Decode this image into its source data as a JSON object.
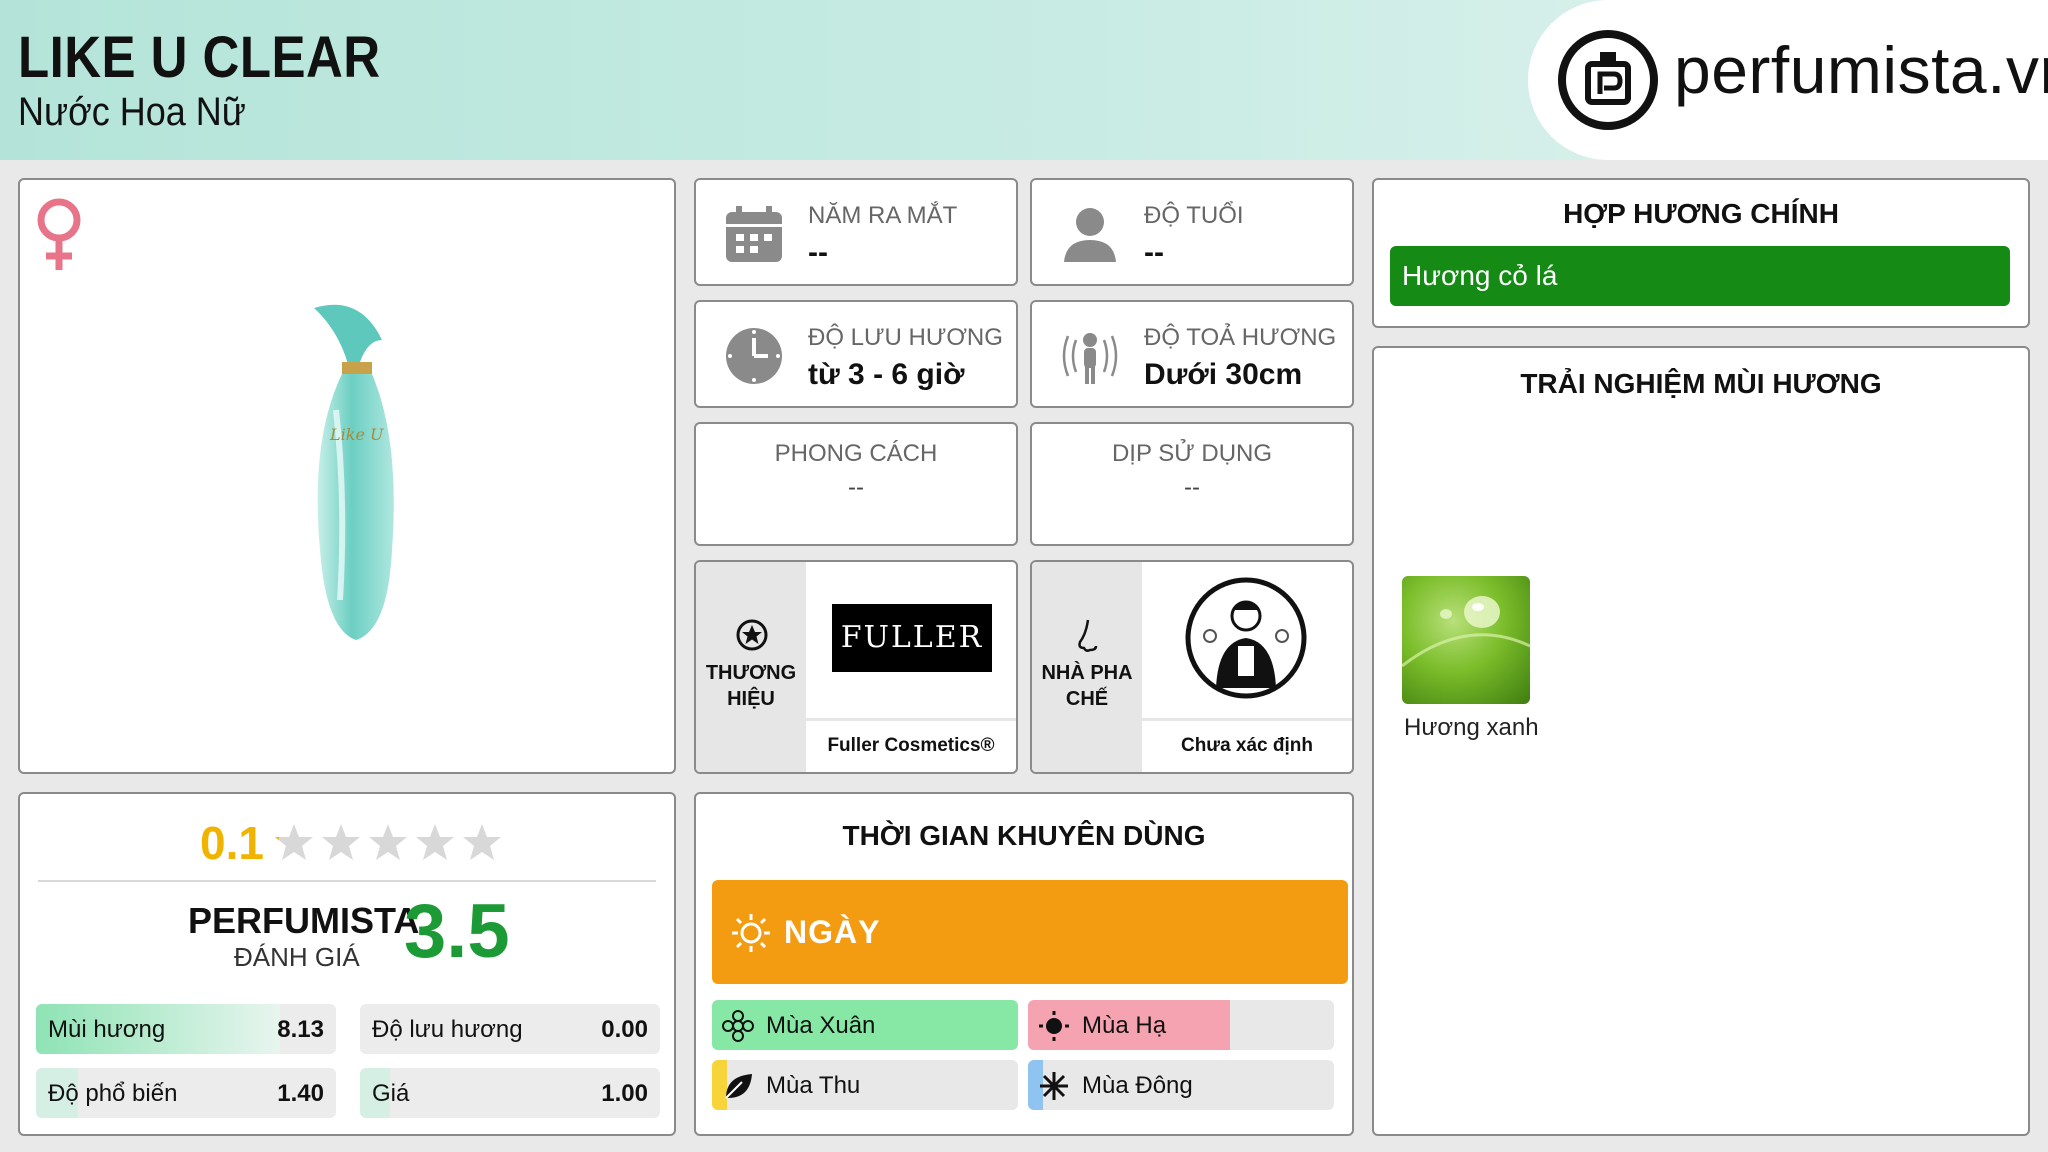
{
  "header": {
    "title": "LIKE U CLEAR",
    "subtitle": "Nước Hoa Nữ",
    "logo_text": "perfumista.vn"
  },
  "gender_icon": "female-icon",
  "info": {
    "launch_year": {
      "label": "NĂM RA MẮT",
      "value": "--",
      "icon": "calendar-icon"
    },
    "age": {
      "label": "ĐỘ TUỔI",
      "value": "--",
      "icon": "user-icon"
    },
    "longevity": {
      "label": "ĐỘ LƯU HƯƠNG",
      "value": "từ 3 - 6 giờ",
      "icon": "clock-icon"
    },
    "sillage": {
      "label": "ĐỘ TOẢ HƯƠNG",
      "value": "Dưới 30cm",
      "icon": "sillage-icon"
    },
    "style": {
      "label": "PHONG CÁCH",
      "value": "--"
    },
    "occasion": {
      "label": "DỊP SỬ DỤNG",
      "value": "--"
    }
  },
  "brand": {
    "label_line1": "THƯƠNG",
    "label_line2": "HIỆU",
    "logo_text": "FULLER",
    "name": "Fuller Cosmetics®"
  },
  "perfumer": {
    "label_line1": "NHÀ PHA",
    "label_line2": "CHẾ",
    "name": "Chưa xác định"
  },
  "rating": {
    "user_score": "0.1",
    "stars_total": 5,
    "stars_filled": 0.1,
    "perfumista_label": "PERFUMISTA",
    "perfumista_sub": "ĐÁNH GIÁ",
    "perfumista_score": "3.5",
    "metrics": [
      {
        "label": "Mùi hương",
        "value": "8.13",
        "fill": 0.813
      },
      {
        "label": "Độ lưu hương",
        "value": "0.00",
        "fill": 0.0
      },
      {
        "label": "Độ phổ biến",
        "value": "1.40",
        "fill": 0.14
      },
      {
        "label": "Giá",
        "value": "1.00",
        "fill": 0.1
      }
    ]
  },
  "time": {
    "title": "THỜI GIAN KHUYÊN DÙNG",
    "day_label": "NGÀY",
    "seasons": [
      {
        "label": "Mùa Xuân",
        "icon": "flower-icon",
        "fill": 1.0,
        "color": "#86e8a4"
      },
      {
        "label": "Mùa Hạ",
        "icon": "sun-icon",
        "fill": 0.66,
        "color": "#f5a3b0"
      },
      {
        "label": "Mùa Thu",
        "icon": "leaf-icon",
        "fill": 0.05,
        "color": "#f7d43a"
      },
      {
        "label": "Mùa Đông",
        "icon": "snowflake-icon",
        "fill": 0.05,
        "color": "#8fc3f0"
      }
    ]
  },
  "notes": {
    "title": "HỢP HƯƠNG CHÍNH",
    "main_accord": "Hương cỏ lá",
    "main_accord_color": "#158a15"
  },
  "experience": {
    "title": "TRẢI NGHIỆM MÙI HƯƠNG",
    "items": [
      {
        "label": "Hương xanh"
      }
    ]
  }
}
